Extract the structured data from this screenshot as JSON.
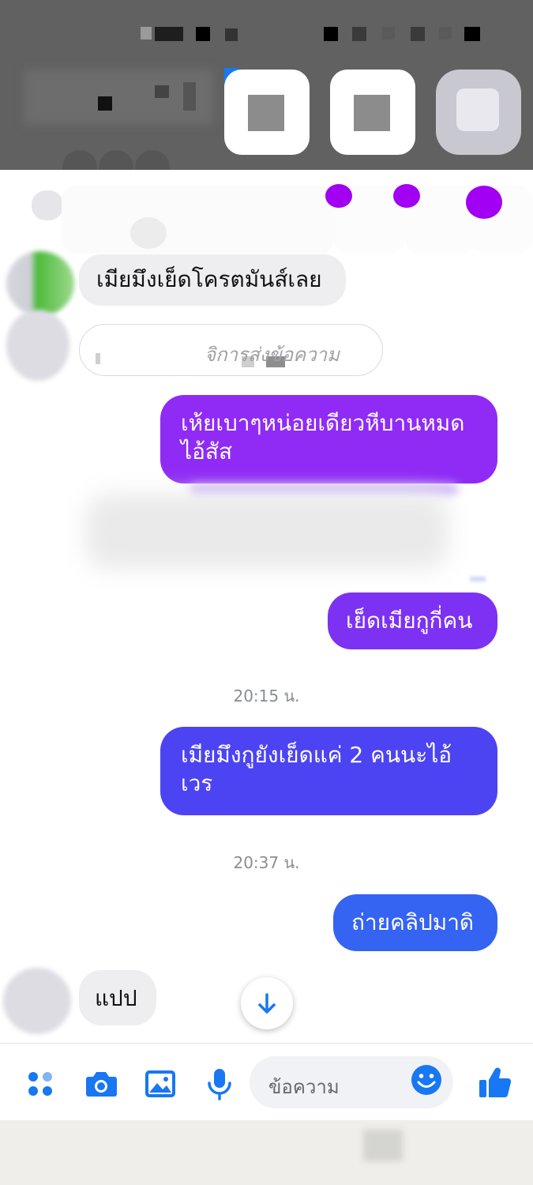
{
  "messages": {
    "m1": "เมียมึงเย็ดโครตมันส์เลย",
    "reply_hint": "จิการส่งข้อความ",
    "m2": "เห้ยเบาๆหน่อยเดียวหีบานหมด ไอ้สัส",
    "m3": "เย็ดเมียกูกี่คน",
    "time1": "20:15 น.",
    "m4": "เมียมึงกูยังเย็ดแค่ 2 คนนะไอ้ เวร",
    "time2": "20:37 น.",
    "m5": "ถ่ายคลิปมาดิ",
    "m6": "แปป"
  },
  "composer": {
    "placeholder": "ข้อความ",
    "icons": [
      "menu-dots-icon",
      "camera-icon",
      "image-icon",
      "microphone-icon",
      "emoji-icon",
      "thumbs-up-icon"
    ]
  },
  "colors": {
    "accent": "#1877f2",
    "sent_purple": "#8f2bf5",
    "sent_indigo": "#4c44f2",
    "sent_blue": "#3563f2",
    "received_bg": "#eeeef0"
  }
}
